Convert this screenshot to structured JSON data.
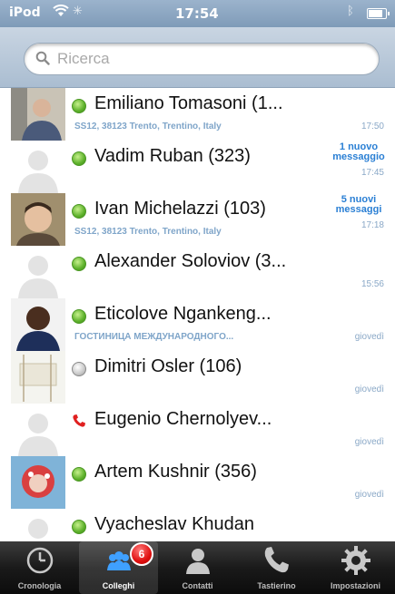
{
  "status_bar": {
    "carrier": "iPod",
    "time": "17:54",
    "battery_level": 0.85
  },
  "search": {
    "placeholder": "Ricerca"
  },
  "contacts": [
    {
      "name": "Emiliano Tomasoni (1...",
      "subtitle": "SS12, 38123 Trento, Trentino, Italy",
      "time": "17:50",
      "status": "online",
      "message": ""
    },
    {
      "name": "Vadim Ruban (323)",
      "subtitle": "",
      "time": "17:45",
      "status": "online",
      "message": "1 nuovo messaggio"
    },
    {
      "name": "Ivan Michelazzi (103)",
      "subtitle": "SS12, 38123 Trento, Trentino, Italy",
      "time": "17:18",
      "status": "online",
      "message": "5 nuovi messaggi"
    },
    {
      "name": "Alexander Soloviov (3...",
      "subtitle": "",
      "time": "15:56",
      "status": "online",
      "message": ""
    },
    {
      "name": "Eticolove Ngankeng...",
      "subtitle": "ГОСТИНИЦА МЕЖДУНАРОДНОГО...",
      "time": "giovedì",
      "status": "online",
      "message": ""
    },
    {
      "name": "Dimitri Osler (106)",
      "subtitle": "",
      "time": "giovedì",
      "status": "offline",
      "message": ""
    },
    {
      "name": "Eugenio Chernolyev...",
      "subtitle": "",
      "time": "giovedì",
      "status": "call",
      "message": ""
    },
    {
      "name": "Artem Kushnir (356)",
      "subtitle": "",
      "time": "giovedì",
      "status": "online",
      "message": ""
    },
    {
      "name": "Vyacheslav Khudan",
      "subtitle": "",
      "time": "",
      "status": "online",
      "message": ""
    }
  ],
  "tabs": [
    {
      "label": "Cronologia",
      "icon": "clock-icon"
    },
    {
      "label": "Colleghi",
      "icon": "colleagues-icon",
      "badge": "6"
    },
    {
      "label": "Contatti",
      "icon": "contact-icon"
    },
    {
      "label": "Tastierino",
      "icon": "phone-icon"
    },
    {
      "label": "Impostazioni",
      "icon": "gear-icon"
    }
  ],
  "colors": {
    "presence_online": "#5db12b",
    "message_accent": "#2a7fd4",
    "badge": "#e01010"
  }
}
